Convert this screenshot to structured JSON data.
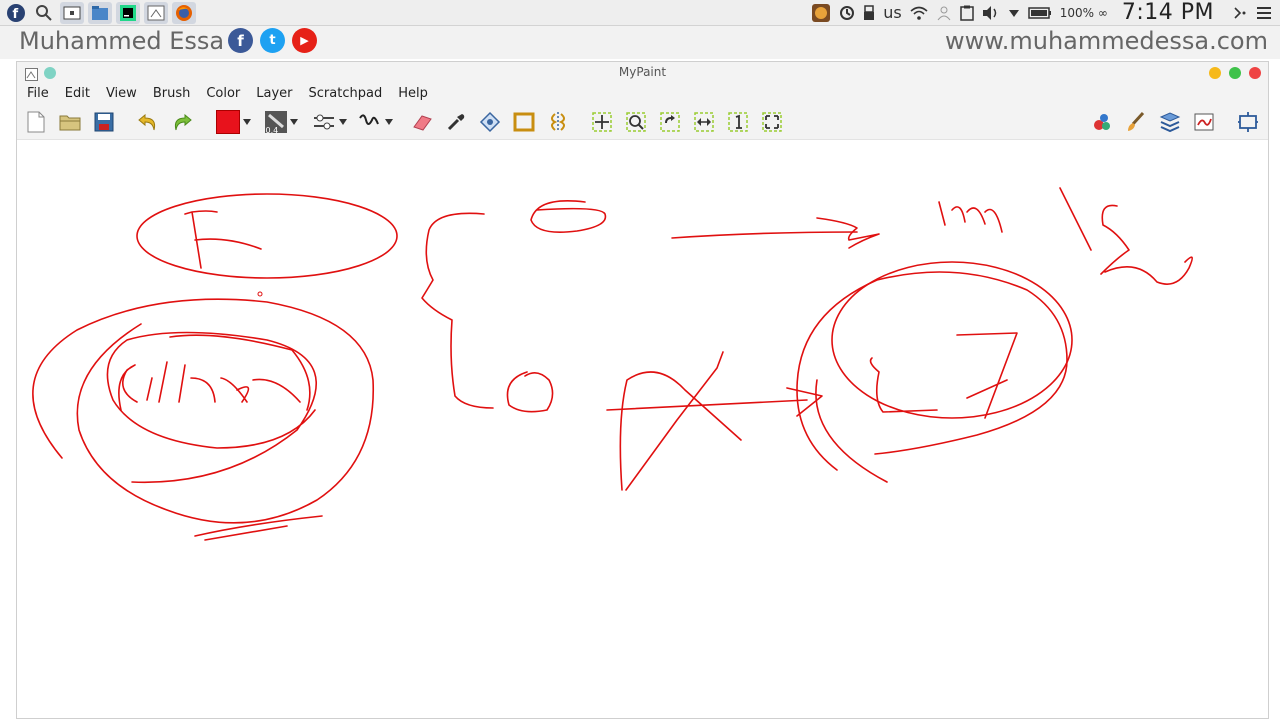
{
  "topbar": {
    "tray_keyboard": "us",
    "battery": "100% ∞",
    "clock": "7:14 PM"
  },
  "banner": {
    "author": "Muhammed Essa",
    "website": "www.muhammedessa.com",
    "social": [
      {
        "name": "facebook",
        "glyph": "f",
        "color": "#3b5998"
      },
      {
        "name": "twitter",
        "glyph": "t",
        "color": "#1da1f2"
      },
      {
        "name": "youtube",
        "glyph": "▶",
        "color": "#e62117"
      }
    ]
  },
  "window": {
    "title": "MyPaint",
    "menus": [
      "File",
      "Edit",
      "View",
      "Brush",
      "Color",
      "Layer",
      "Scratchpad",
      "Help"
    ],
    "brush_size": "0.4",
    "color_swatch": "#e8121c",
    "ink_color": "#e01010"
  }
}
